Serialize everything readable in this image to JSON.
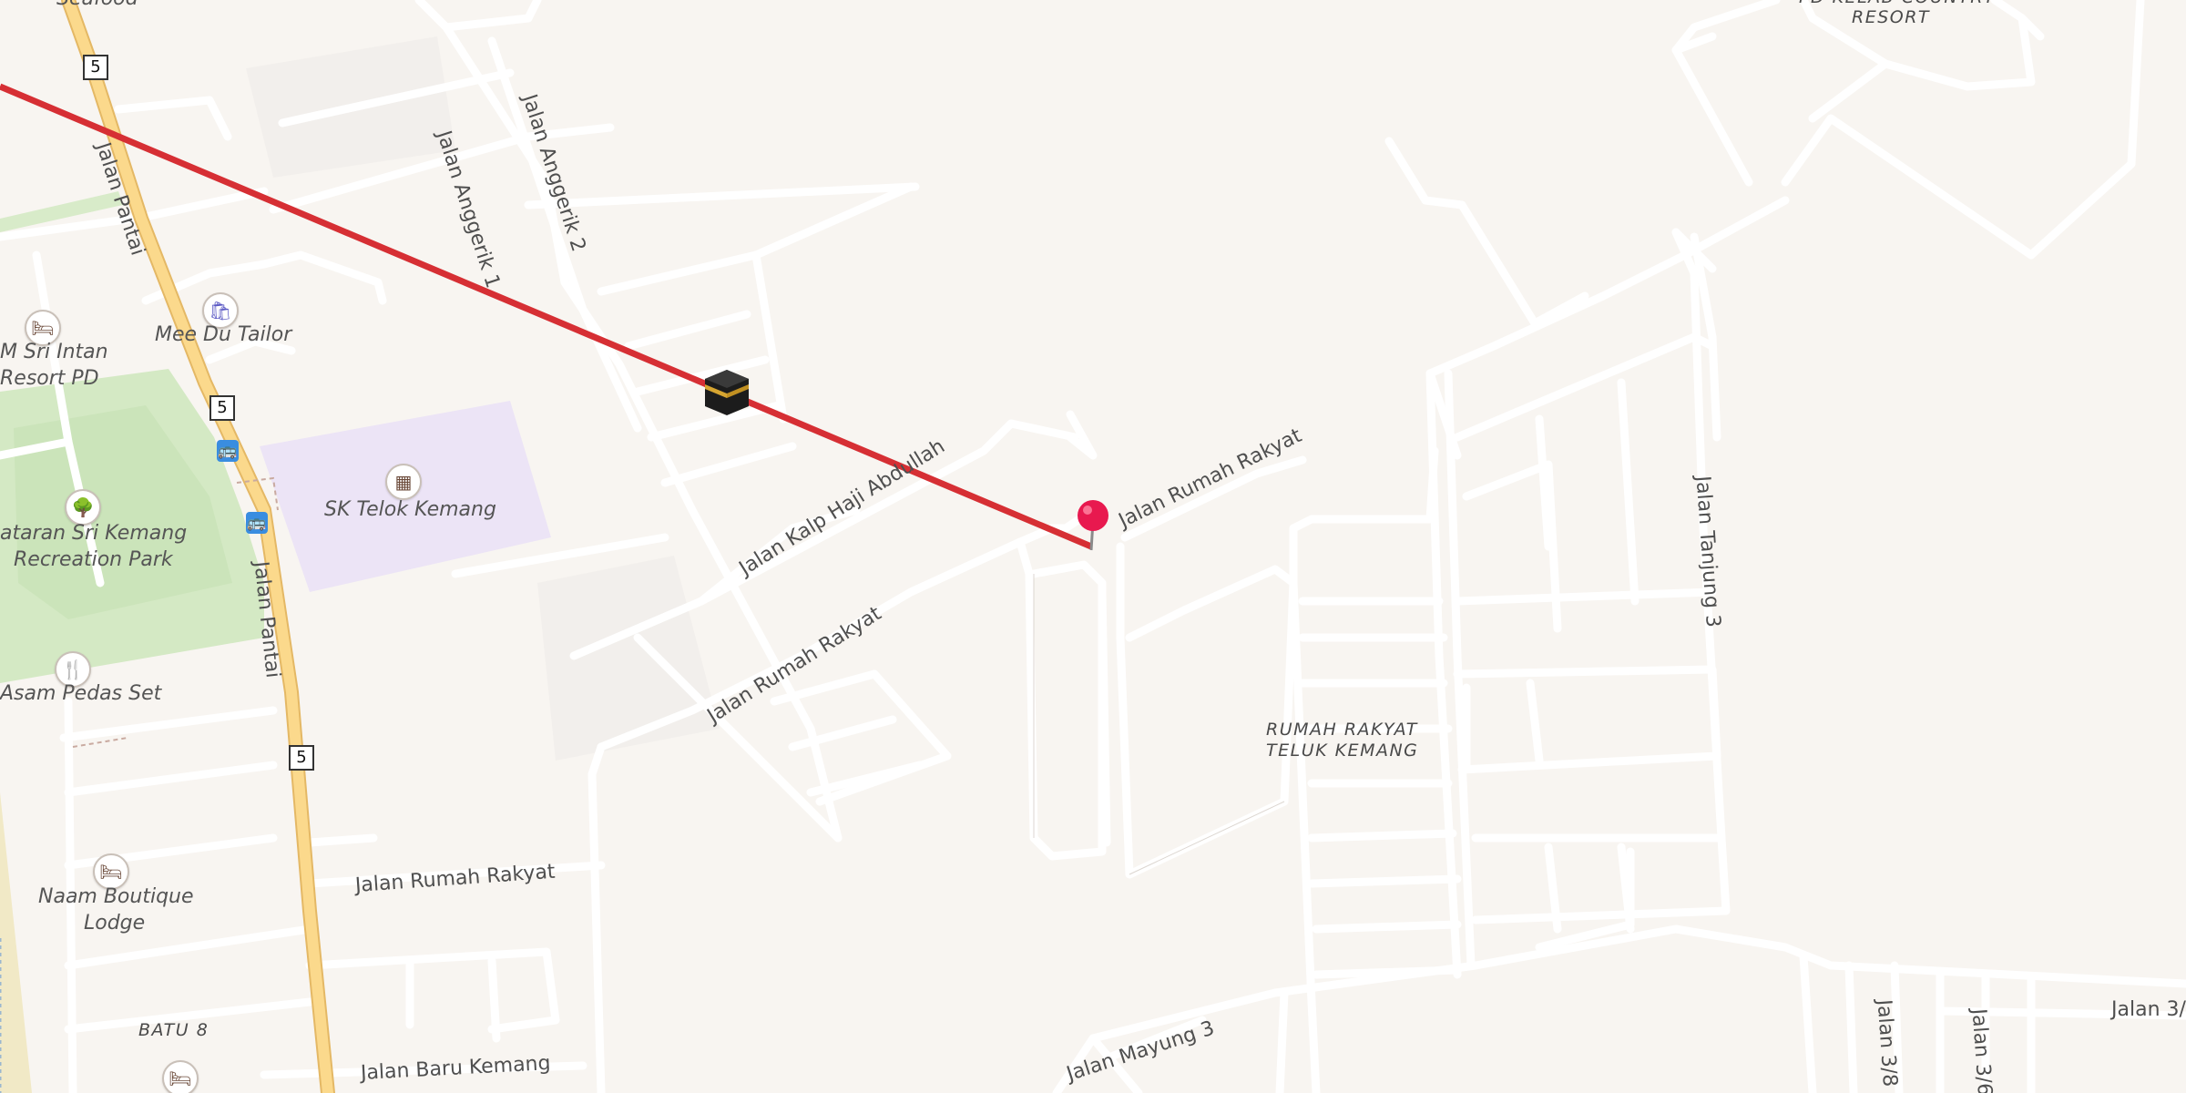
{
  "map": {
    "route_color": "#d62f34",
    "pin_color": "#e8194f",
    "road_color": "#ffffff",
    "highway_color": "#fbd98c",
    "park_color": "#cfe7c0",
    "school_color": "#ece4f6"
  },
  "streets": {
    "jalan_pantai_1": "Jalan Pantai",
    "jalan_pantai_2": "Jalan Pantai",
    "jalan_anggerik_1": "Jalan Anggerik 1",
    "jalan_anggerik_2": "Jalan Anggerik 2",
    "jalan_kalp": "Jalan Kalp Haji Abdullah",
    "jalan_rumah_rakyat_1": "Jalan Rumah Rakyat",
    "jalan_rumah_rakyat_2": "Jalan Rumah Rakyat",
    "jalan_rumah_rakyat_3": "Jalan Rumah Rakyat",
    "jalan_tanjung_3": "Jalan Tanjung 3",
    "jalan_mayung_3": "Jalan Mayung 3",
    "jalan_baru_kemang": "Jalan Baru Kemang",
    "jalan_3_8": "Jalan 3/8",
    "jalan_3_6": "Jalan 3/6",
    "jalan_3_x": "Jalan 3/"
  },
  "pois": {
    "seafood": "Seafood",
    "mee_du_tailor": "Mee Du Tailor",
    "sri_intan_1": "M Sri Intan",
    "sri_intan_2": "Resort PD",
    "sk_telok_kemang": "SK Telok Kemang",
    "park_1": "ataran Sri Kemang",
    "park_2": "Recreation Park",
    "asam_pedas": "Asam Pedas Set",
    "naam_1": "Naam Boutique",
    "naam_2": "Lodge",
    "batu_8": "BATU 8",
    "resort_1": "PD KELAB COUNTRY",
    "resort_2": "RESORT",
    "rumah_1": "RUMAH RAKYAT",
    "rumah_2": "TELUK KEMANG"
  },
  "shields": {
    "route": "5"
  },
  "icons": {
    "kaaba": "kaaba-icon",
    "pin": "location-pin-icon",
    "bus": "bus-stop-icon",
    "hotel": "hotel-icon",
    "shop": "shopping-bag-icon",
    "school": "school-icon",
    "park": "tree-icon",
    "restaurant": "restaurant-icon"
  }
}
